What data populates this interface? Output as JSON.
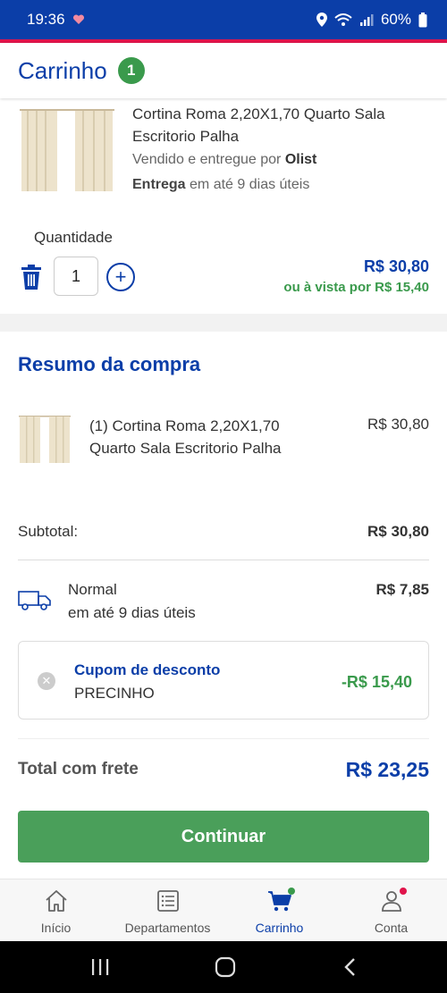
{
  "status": {
    "time": "19:36",
    "battery": "60%"
  },
  "header": {
    "title": "Carrinho",
    "badge": "1"
  },
  "product": {
    "name": "Cortina Roma 2,20X1,70 Quarto Sala Escritorio Palha",
    "seller_prefix": "Vendido e entregue por",
    "seller": "Olist",
    "delivery_bold": "Entrega",
    "delivery_rest": "em até 9 dias úteis",
    "quantity_label": "Quantidade",
    "quantity": "1",
    "price": "R$ 30,80",
    "cash_price": "ou à vista por R$ 15,40"
  },
  "summary": {
    "title": "Resumo da compra",
    "item": "(1) Cortina Roma 2,20X1,70 Quarto Sala Escritorio Palha",
    "item_price": "R$ 30,80",
    "subtotal_label": "Subtotal:",
    "subtotal": "R$ 30,80",
    "shipping_name": "Normal",
    "shipping_time": "em até 9 dias úteis",
    "shipping_price": "R$ 7,85",
    "coupon_title": "Cupom de desconto",
    "coupon_code": "PRECINHO",
    "coupon_value": "-R$ 15,40",
    "total_label": "Total com frete",
    "total": "R$ 23,25"
  },
  "continue_label": "Continuar",
  "nav": [
    {
      "label": "Início",
      "icon": "home-icon"
    },
    {
      "label": "Departamentos",
      "icon": "list-icon"
    },
    {
      "label": "Carrinho",
      "icon": "cart-icon"
    },
    {
      "label": "Conta",
      "icon": "user-icon"
    }
  ],
  "colors": {
    "primary": "#0b3ea8",
    "green": "#3a9a4c",
    "button": "#4a9f5a",
    "accent": "#e0144b"
  }
}
